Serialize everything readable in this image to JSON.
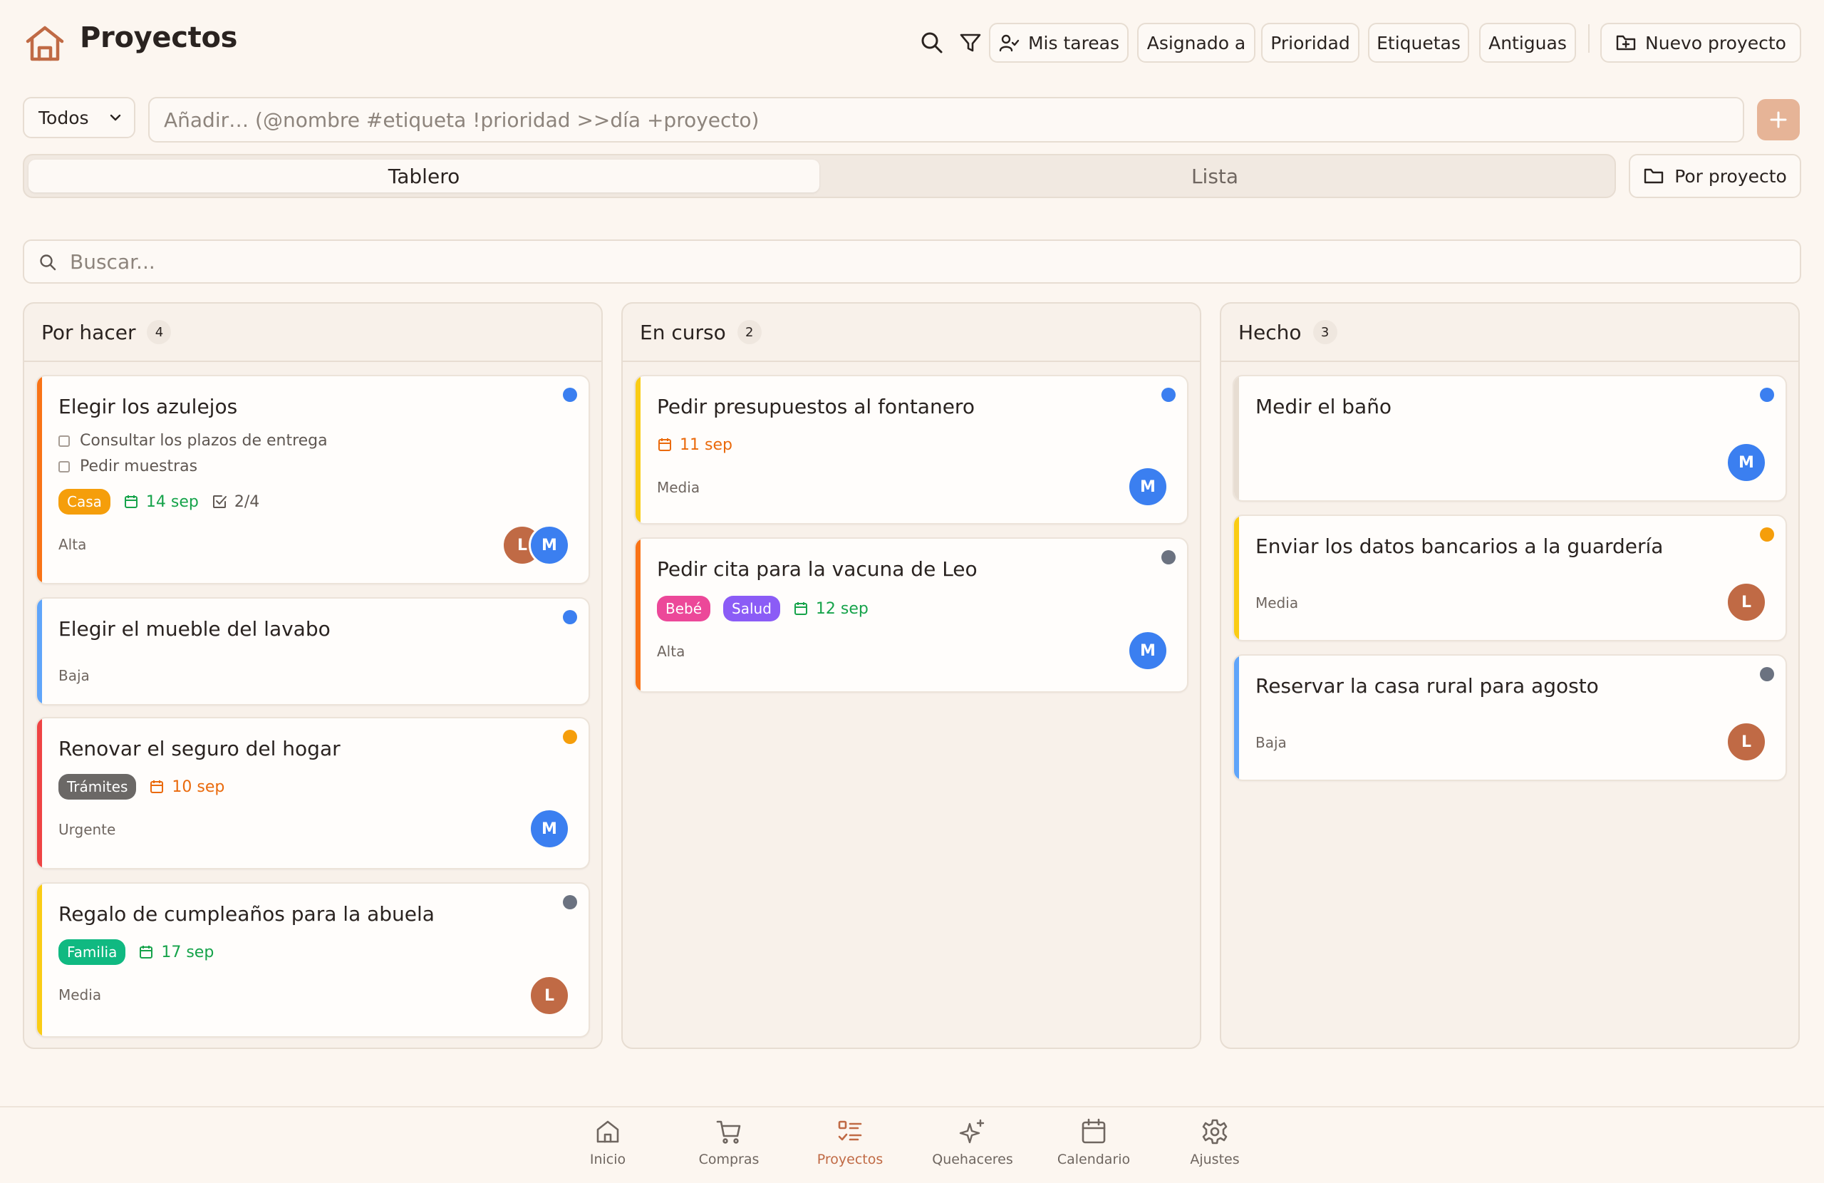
{
  "header": {
    "title": "Proyectos",
    "logo_icon": "home-icon",
    "buttons": {
      "my_tasks": "Mis tareas",
      "assigned_to": "Asignado a",
      "priority": "Prioridad",
      "tags": "Etiquetas",
      "old": "Antiguas",
      "new_project": "Nuevo proyecto"
    }
  },
  "add_bar": {
    "filter_value": "Todos",
    "placeholder": "Añadir… (@nombre #etiqueta !prioridad >>día +proyecto)",
    "add_icon": "plus-icon"
  },
  "view": {
    "tabs": [
      "Tablero",
      "Lista"
    ],
    "active_tab": "Tablero",
    "group_by": "Por proyecto"
  },
  "search": {
    "placeholder": "Buscar..."
  },
  "colors": {
    "accent": "#c06a45",
    "blue": "#3b7ff0",
    "orange_dot": "#f59e0b",
    "gray_dot": "#6b7280",
    "green_date": "#16a34a",
    "orange_date": "#ea6a0c"
  },
  "columns": [
    {
      "title": "Por hacer",
      "count": "4",
      "cards": [
        {
          "title": "Elegir los azulejos",
          "accent": "#f97316",
          "dot": "#3b7ff0",
          "subtasks": [
            "Consultar los plazos de entrega",
            "Pedir muestras"
          ],
          "tags": [
            {
              "label": "Casa",
              "color": "#f59e0b"
            }
          ],
          "date": "14 sep",
          "date_color": "#16a34a",
          "progress": "2/4",
          "priority": "Alta",
          "avatars": [
            "L",
            "M"
          ]
        },
        {
          "title": "Elegir el mueble del lavabo",
          "accent": "#60a5fa",
          "dot": "#3b7ff0",
          "priority": "Baja",
          "avatars": []
        },
        {
          "title": "Renovar el seguro del hogar",
          "accent": "#ef4444",
          "dot": "#f59e0b",
          "tags": [
            {
              "label": "Trámites",
              "color": "#6b6866"
            }
          ],
          "date": "10 sep",
          "date_color": "#ea6a0c",
          "priority": "Urgente",
          "avatars": [
            "M"
          ]
        },
        {
          "title": "Regalo de cumpleaños para la abuela",
          "accent": "#facc15",
          "dot": "#6b7280",
          "tags": [
            {
              "label": "Familia",
              "color": "#10b981"
            }
          ],
          "date": "17 sep",
          "date_color": "#16a34a",
          "priority": "Media",
          "avatars": [
            "L"
          ]
        }
      ]
    },
    {
      "title": "En curso",
      "count": "2",
      "cards": [
        {
          "title": "Pedir presupuestos al fontanero",
          "accent": "#facc15",
          "dot": "#3b7ff0",
          "date": "11 sep",
          "date_color": "#ea6a0c",
          "priority": "Media",
          "avatars": [
            "M"
          ]
        },
        {
          "title": "Pedir cita para la vacuna de Leo",
          "accent": "#f97316",
          "dot": "#6b7280",
          "tags": [
            {
              "label": "Bebé",
              "color": "#ec4899"
            },
            {
              "label": "Salud",
              "color": "#8b5cf6"
            }
          ],
          "date": "12 sep",
          "date_color": "#16a34a",
          "priority": "Alta",
          "avatars": [
            "M"
          ]
        }
      ]
    },
    {
      "title": "Hecho",
      "count": "3",
      "cards": [
        {
          "title": "Medir el baño",
          "accent": "#e7ddd2",
          "dot": "#3b7ff0",
          "avatars": [
            "M"
          ]
        },
        {
          "title": "Enviar los datos bancarios a la guardería",
          "accent": "#facc15",
          "dot": "#f59e0b",
          "priority": "Media",
          "avatars": [
            "L"
          ]
        },
        {
          "title": "Reservar la casa rural para agosto",
          "accent": "#60a5fa",
          "dot": "#6b7280",
          "priority": "Baja",
          "avatars": [
            "L"
          ]
        }
      ]
    }
  ],
  "bottom_nav": [
    {
      "label": "Inicio",
      "icon": "home-icon"
    },
    {
      "label": "Compras",
      "icon": "cart-icon"
    },
    {
      "label": "Proyectos",
      "icon": "checklist-icon",
      "active": true
    },
    {
      "label": "Quehaceres",
      "icon": "sparkles-icon"
    },
    {
      "label": "Calendario",
      "icon": "calendar-icon"
    },
    {
      "label": "Ajustes",
      "icon": "gear-icon"
    }
  ]
}
